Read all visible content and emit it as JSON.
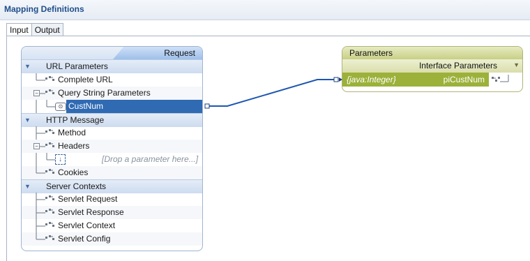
{
  "header": {
    "title": "Mapping Definitions"
  },
  "tabs": [
    {
      "label": "Input",
      "active": true
    },
    {
      "label": "Output",
      "active": false
    }
  ],
  "request_box": {
    "title": "Request",
    "sections": [
      {
        "label": "URL Parameters",
        "items": [
          {
            "label": "Complete URL"
          },
          {
            "label": "Query String Parameters",
            "expanded": true,
            "children": [
              {
                "label": "CustNum",
                "selected": true
              }
            ]
          }
        ]
      },
      {
        "label": "HTTP Message",
        "items": [
          {
            "label": "Method"
          },
          {
            "label": "Headers",
            "expanded": true,
            "children": [
              {
                "placeholder": "[Drop a parameter here...]"
              }
            ]
          },
          {
            "label": "Cookies"
          }
        ]
      },
      {
        "label": "Server Contexts",
        "items": [
          {
            "label": "Servlet Request"
          },
          {
            "label": "Servlet Response"
          },
          {
            "label": "Servlet Context"
          },
          {
            "label": "Servlet Config"
          }
        ]
      }
    ]
  },
  "parameters_box": {
    "title": "Parameters",
    "subheader": "Interface Parameters",
    "param": {
      "type": "{java:Integer}",
      "name": "piCustNum"
    }
  },
  "colors": {
    "accent": "#2f6ab3",
    "section_header": "#cddcf0",
    "param_row": "#9bb13a",
    "connection_line": "#1f56b0"
  }
}
